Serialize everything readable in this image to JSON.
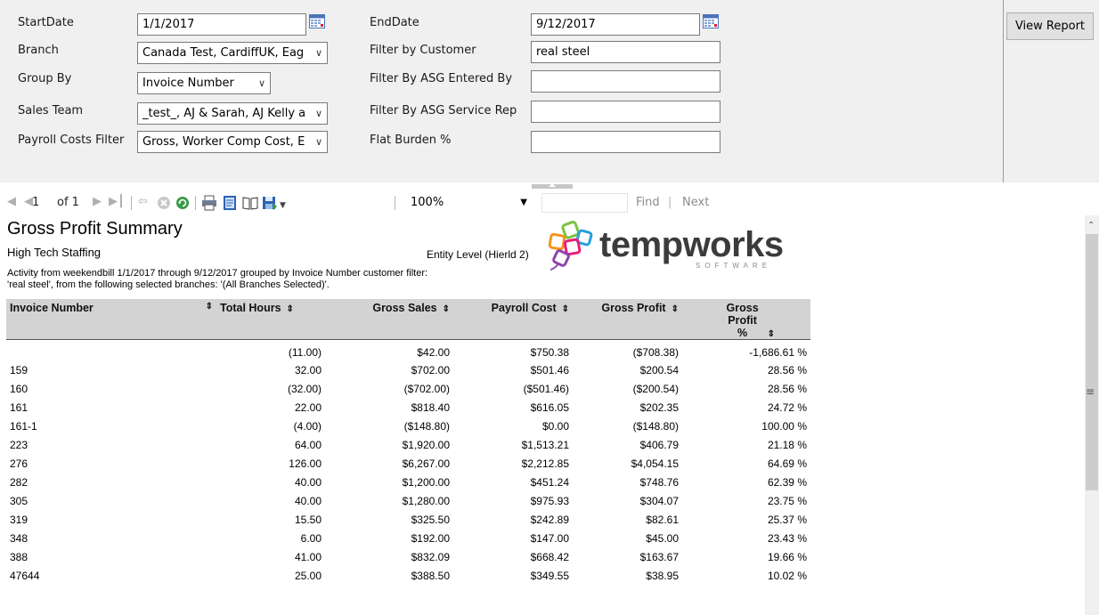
{
  "params": {
    "start_date": {
      "label": "StartDate",
      "value": "1/1/2017"
    },
    "end_date": {
      "label": "EndDate",
      "value": "9/12/2017"
    },
    "branch": {
      "label": "Branch",
      "value": "Canada Test, CardiffUK, Eag"
    },
    "filter_customer": {
      "label": "Filter by Customer",
      "value": "real steel"
    },
    "group_by": {
      "label": "Group By",
      "value": "Invoice Number"
    },
    "filter_asg_entered": {
      "label": "Filter By ASG Entered By",
      "value": ""
    },
    "sales_team": {
      "label": "Sales Team",
      "value": "_test_, AJ & Sarah, AJ Kelly a"
    },
    "filter_asg_rep": {
      "label": "Filter By ASG Service Rep",
      "value": ""
    },
    "payroll_costs": {
      "label": "Payroll Costs Filter",
      "value": "Gross, Worker Comp Cost, E"
    },
    "flat_burden": {
      "label": "Flat Burden %",
      "value": ""
    },
    "view_report_label": "View Report"
  },
  "toolbar": {
    "page_current": "1",
    "page_of": "of 1",
    "zoom": "100%",
    "find_label": "Find",
    "next_label": "Next",
    "find_value": ""
  },
  "report": {
    "title": "Gross Profit Summary",
    "company": "High Tech Staffing",
    "entity_level": "Entity Level (Hierld 2)",
    "description_line1": "Activity from weekendbill 1/1/2017 through 9/12/2017 grouped by Invoice Number customer filter:",
    "description_line2": "'real steel', from the following selected branches: '(All Branches Selected)'.",
    "logo": {
      "word": "tempworks",
      "sub": "SOFTWARE"
    },
    "columns": [
      "Invoice Number",
      "Total Hours",
      "Gross Sales",
      "Payroll Cost",
      "Gross Profit",
      "Gross Profit %"
    ],
    "rows": [
      {
        "invoice": "",
        "hours": "(11.00)",
        "sales": "$42.00",
        "payroll": "$750.38",
        "profit": "($708.38)",
        "pct": "-1,686.61 %"
      },
      {
        "invoice": "159",
        "hours": "32.00",
        "sales": "$702.00",
        "payroll": "$501.46",
        "profit": "$200.54",
        "pct": "28.56 %"
      },
      {
        "invoice": "160",
        "hours": "(32.00)",
        "sales": "($702.00)",
        "payroll": "($501.46)",
        "profit": "($200.54)",
        "pct": "28.56 %"
      },
      {
        "invoice": "161",
        "hours": "22.00",
        "sales": "$818.40",
        "payroll": "$616.05",
        "profit": "$202.35",
        "pct": "24.72 %"
      },
      {
        "invoice": "161-1",
        "hours": "(4.00)",
        "sales": "($148.80)",
        "payroll": "$0.00",
        "profit": "($148.80)",
        "pct": "100.00 %"
      },
      {
        "invoice": "223",
        "hours": "64.00",
        "sales": "$1,920.00",
        "payroll": "$1,513.21",
        "profit": "$406.79",
        "pct": "21.18 %"
      },
      {
        "invoice": "276",
        "hours": "126.00",
        "sales": "$6,267.00",
        "payroll": "$2,212.85",
        "profit": "$4,054.15",
        "pct": "64.69 %"
      },
      {
        "invoice": "282",
        "hours": "40.00",
        "sales": "$1,200.00",
        "payroll": "$451.24",
        "profit": "$748.76",
        "pct": "62.39 %"
      },
      {
        "invoice": "305",
        "hours": "40.00",
        "sales": "$1,280.00",
        "payroll": "$975.93",
        "profit": "$304.07",
        "pct": "23.75 %"
      },
      {
        "invoice": "319",
        "hours": "15.50",
        "sales": "$325.50",
        "payroll": "$242.89",
        "profit": "$82.61",
        "pct": "25.37 %"
      },
      {
        "invoice": "348",
        "hours": "6.00",
        "sales": "$192.00",
        "payroll": "$147.00",
        "profit": "$45.00",
        "pct": "23.43 %"
      },
      {
        "invoice": "388",
        "hours": "41.00",
        "sales": "$832.09",
        "payroll": "$668.42",
        "profit": "$163.67",
        "pct": "19.66 %"
      },
      {
        "invoice": "47644",
        "hours": "25.00",
        "sales": "$388.50",
        "payroll": "$349.55",
        "profit": "$38.95",
        "pct": "10.02 %"
      }
    ]
  }
}
